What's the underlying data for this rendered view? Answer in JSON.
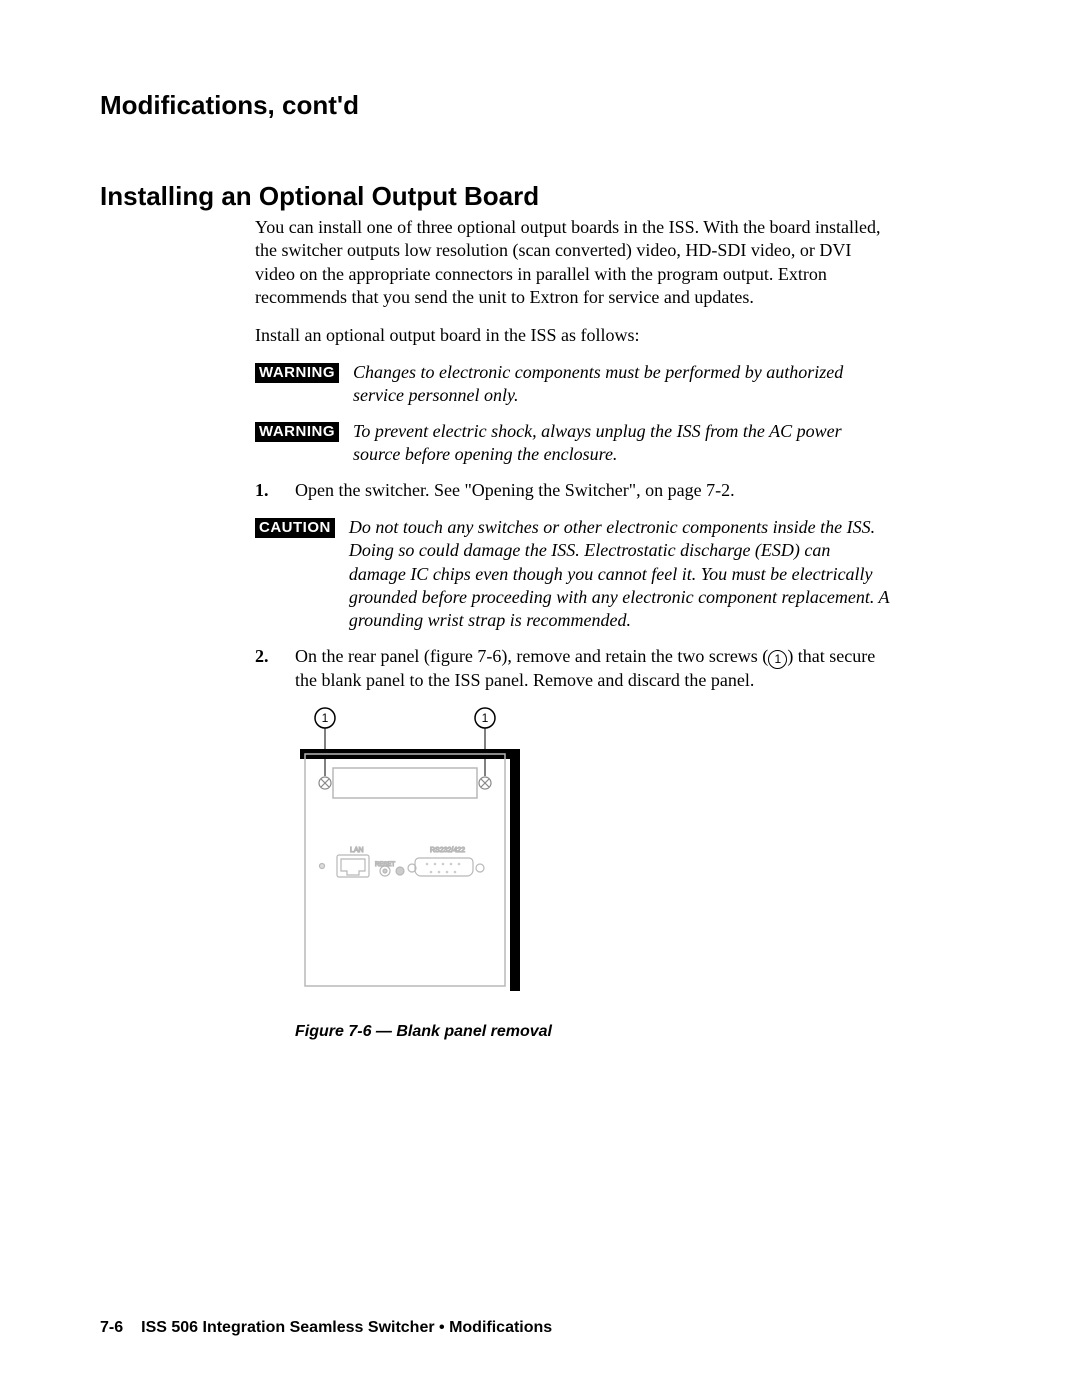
{
  "running_head": "Modifications, cont'd",
  "section_title": "Installing an Optional Output Board",
  "intro_para": "You can install one of three optional output boards in the ISS.  With the board installed, the switcher outputs low resolution (scan converted) video, HD-SDI video, or DVI video on the appropriate connectors in parallel with the program output.  Extron recommends that you send the unit to Extron for service and updates.",
  "lead_in": "Install an optional output board in the ISS as follows:",
  "warn1_label": "WARNING",
  "warn1_text": "Changes to electronic components must be performed by authorized service personnel only.",
  "warn2_label": "WARNING",
  "warn2_text": "To prevent electric shock, always unplug the ISS from the AC power source before opening the enclosure.",
  "step1_num": "1.",
  "step1_text": "Open the switcher.  See \"Opening the Switcher\", on page 7-2.",
  "caution_label": "CAUTION",
  "caution_text": "Do not touch any switches or other electronic components inside the ISS.  Doing so could damage the ISS.  Electrostatic discharge (ESD) can damage IC chips even though you cannot feel it.  You must be electrically grounded before proceeding with any electronic component replacement.  A grounding wrist strap is recommended.",
  "step2_num": "2.",
  "step2_text_a": "On the rear panel (figure 7-6), remove and retain the two screws (",
  "step2_callout": "1",
  "step2_text_b": ") that secure the blank panel to the ISS panel.  Remove and discard the panel.",
  "figure": {
    "callout_left": "1",
    "callout_right": "1",
    "lan_label": "LAN",
    "rs_label": "RS232/422",
    "reset_label": "RESET"
  },
  "figure_caption": "Figure 7-6 — Blank panel removal",
  "footer_page": "7-6",
  "footer_text": "ISS 506 Integration Seamless Switcher • Modifications"
}
